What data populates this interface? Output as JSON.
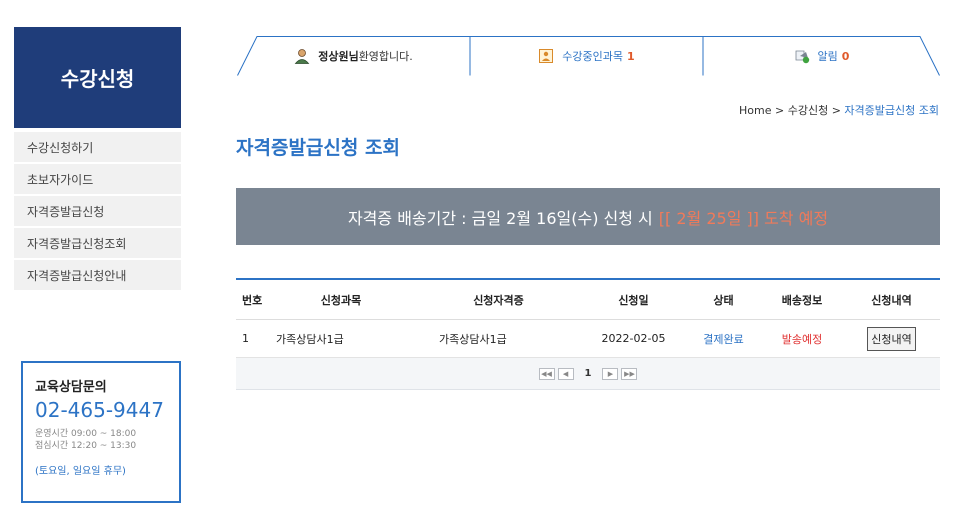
{
  "sidebar": {
    "title": "수강신청",
    "items": [
      {
        "label": "수강신청하기"
      },
      {
        "label": "초보자가이드"
      },
      {
        "label": "자격증발급신청"
      },
      {
        "label": "자격증발급신청조회"
      },
      {
        "label": "자격증발급신청안내"
      }
    ]
  },
  "counsel": {
    "title": "교육상담문의",
    "phone": "02-465-9447",
    "hours1": "운영시간 09:00 ~ 18:00",
    "hours2": "점심시간 12:20 ~ 13:30",
    "closed": "(토요일, 일요일 휴무)"
  },
  "topbar": {
    "user_name": "정상원님",
    "welcome": "환영합니다.",
    "courses_label": "수강중인과목",
    "courses_count": "1",
    "alerts_label": "알림",
    "alerts_count": "0"
  },
  "breadcrumb": {
    "home": "Home",
    "sep": ">",
    "section": "수강신청",
    "current": "자격증발급신청 조회"
  },
  "page_title": "자격증발급신청 조회",
  "notice": {
    "text": "자격증 배송기간 : 금일 2월 16일(수) 신청 시",
    "highlight": "[[ 2월 25일 ]] 도착 예정"
  },
  "table": {
    "headers": {
      "no": "번호",
      "course": "신청과목",
      "cert": "신청자격증",
      "date": "신청일",
      "status": "상태",
      "shipping": "배송정보",
      "detail": "신청내역"
    },
    "rows": [
      {
        "no": "1",
        "course": "가족상담사1급",
        "cert": "가족상담사1급",
        "date": "2022-02-05",
        "status": "결제완료",
        "shipping": "발송예정",
        "detail": "신청내역"
      }
    ]
  },
  "pager": {
    "current_page": "1"
  },
  "colors": {
    "sidebar_header": "#1f3d7a",
    "accent": "#2c73c5",
    "notice_bg": "#7a8592",
    "highlight": "#f07a5a",
    "shipping": "#e03030"
  },
  "icons": {
    "user": "user-icon",
    "course": "course-icon",
    "alert": "bell-icon"
  }
}
